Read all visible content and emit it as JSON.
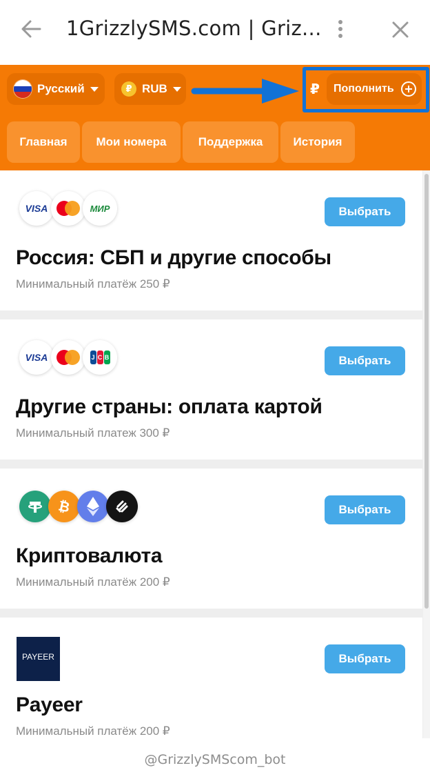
{
  "window": {
    "title": "1GrizzlySMS.com | Griz..."
  },
  "header": {
    "language": "Русский",
    "currency": "RUB",
    "currency_symbol": "₽",
    "topup_symbol": "₽",
    "topup_label": "Пополнить",
    "accent_color": "#f57a05",
    "highlight_color": "#1272d6",
    "tabs": [
      {
        "label": "Главная"
      },
      {
        "label": "Мои номера"
      },
      {
        "label": "Поддержка"
      },
      {
        "label": "История"
      }
    ]
  },
  "payment_methods": [
    {
      "title": "Россия: СБП и другие способы",
      "subtitle": "Минимальный платёж 250 ₽",
      "button": "Выбрать",
      "icons": [
        "visa-icon",
        "mastercard-icon",
        "mir-icon"
      ],
      "visa_text": "VISA",
      "mir_text": "МИР"
    },
    {
      "title": "Другие страны: оплата картой",
      "subtitle": "Минимальный платеж 300 ₽",
      "button": "Выбрать",
      "icons": [
        "visa-icon",
        "mastercard-icon",
        "jcb-icon"
      ],
      "visa_text": "VISA",
      "jcb_letters": [
        "J",
        "C",
        "B"
      ]
    },
    {
      "title": "Криптовалюта",
      "subtitle": "Минимальный платёж 200 ₽",
      "button": "Выбрать",
      "icons": [
        "tether-icon",
        "bitcoin-icon",
        "ethereum-icon",
        "bitget-icon"
      ]
    },
    {
      "title": "Payeer",
      "subtitle": "Минимальный платёж 200 ₽",
      "button": "Выбрать",
      "icons": [
        "payeer-logo"
      ],
      "logo_text": "PAYEER"
    }
  ],
  "footer": {
    "bot_handle": "@GrizzlySMScom_bot"
  }
}
